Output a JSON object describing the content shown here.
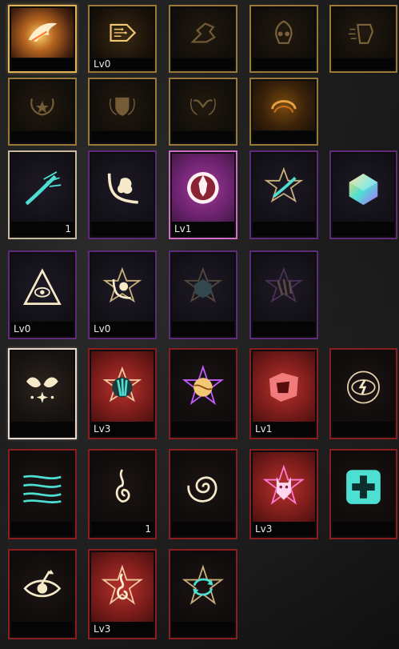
{
  "sections": [
    {
      "name": "gold",
      "slots": [
        {
          "icon": "burning-wing-icon",
          "caption": "",
          "state": "selected"
        },
        {
          "icon": "circuit-arrow-icon",
          "caption": "Lv0",
          "state": "normal"
        },
        {
          "icon": "dragon-artifact-icon",
          "caption": "",
          "state": "locked"
        },
        {
          "icon": "flaming-skull-icon",
          "caption": "",
          "state": "locked"
        },
        {
          "icon": "speed-fist-icon",
          "caption": "",
          "state": "locked"
        },
        {
          "icon": "moon-star-crest-icon",
          "caption": "",
          "state": "locked"
        },
        {
          "icon": "shield-crest-icon",
          "caption": "",
          "state": "locked"
        },
        {
          "icon": "horned-crest-icon",
          "caption": "",
          "state": "locked"
        },
        {
          "icon": "fire-arc-crest-icon",
          "caption": "",
          "state": "active"
        }
      ]
    },
    {
      "name": "purple",
      "slots": [
        {
          "icon": "spirit-claw-slash-icon",
          "caption": "1",
          "state": "normal"
        },
        {
          "icon": "crumbling-curve-icon",
          "caption": "",
          "state": "normal"
        },
        {
          "icon": "shattered-seal-icon",
          "caption": "Lv1",
          "state": "highlighted"
        },
        {
          "icon": "star-claw-slash-icon",
          "caption": "",
          "state": "normal"
        },
        {
          "icon": "prismatic-cube-icon",
          "caption": "",
          "state": "normal"
        },
        {
          "icon": "all-seeing-pyramid-icon",
          "caption": "Lv0",
          "state": "normal"
        },
        {
          "icon": "star-curve-seal-icon",
          "caption": "Lv0",
          "state": "normal"
        },
        {
          "icon": "star-cube-seal-icon",
          "caption": "",
          "state": "locked"
        },
        {
          "icon": "star-claw-marks-icon",
          "caption": "",
          "state": "locked"
        }
      ]
    },
    {
      "name": "red",
      "slots": [
        {
          "icon": "sparkle-hands-icon",
          "caption": "",
          "state": "selected"
        },
        {
          "icon": "teal-claw-star-icon",
          "caption": "Lv3",
          "state": "highlighted"
        },
        {
          "icon": "star-orb-icon",
          "caption": "",
          "state": "normal"
        },
        {
          "icon": "crimson-shatter-icon",
          "caption": "Lv1",
          "state": "highlighted"
        },
        {
          "icon": "lightning-eye-icon",
          "caption": "",
          "state": "normal"
        },
        {
          "icon": "wind-streaks-icon",
          "caption": "",
          "state": "normal"
        },
        {
          "icon": "flame-wisp-icon",
          "caption": "1",
          "state": "normal"
        },
        {
          "icon": "vortex-icon",
          "caption": "",
          "state": "normal"
        },
        {
          "icon": "demon-mask-icon",
          "caption": "Lv3",
          "state": "highlighted"
        },
        {
          "icon": "heal-cross-icon",
          "caption": "",
          "state": "normal"
        },
        {
          "icon": "pierced-eye-icon",
          "caption": "",
          "state": "normal"
        },
        {
          "icon": "flame-wisp-star-icon",
          "caption": "Lv3",
          "state": "highlighted"
        },
        {
          "icon": "cycle-arrows-star-icon",
          "caption": "",
          "state": "normal"
        }
      ]
    }
  ],
  "colors": {
    "gold_frame": "#9a7838",
    "purple_frame": "#5e2a79",
    "red_frame": "#8a1d1d",
    "glow_gold": "#f3c874",
    "glow_teal": "#4de0d2",
    "glow_pink": "#ff7ad1"
  }
}
